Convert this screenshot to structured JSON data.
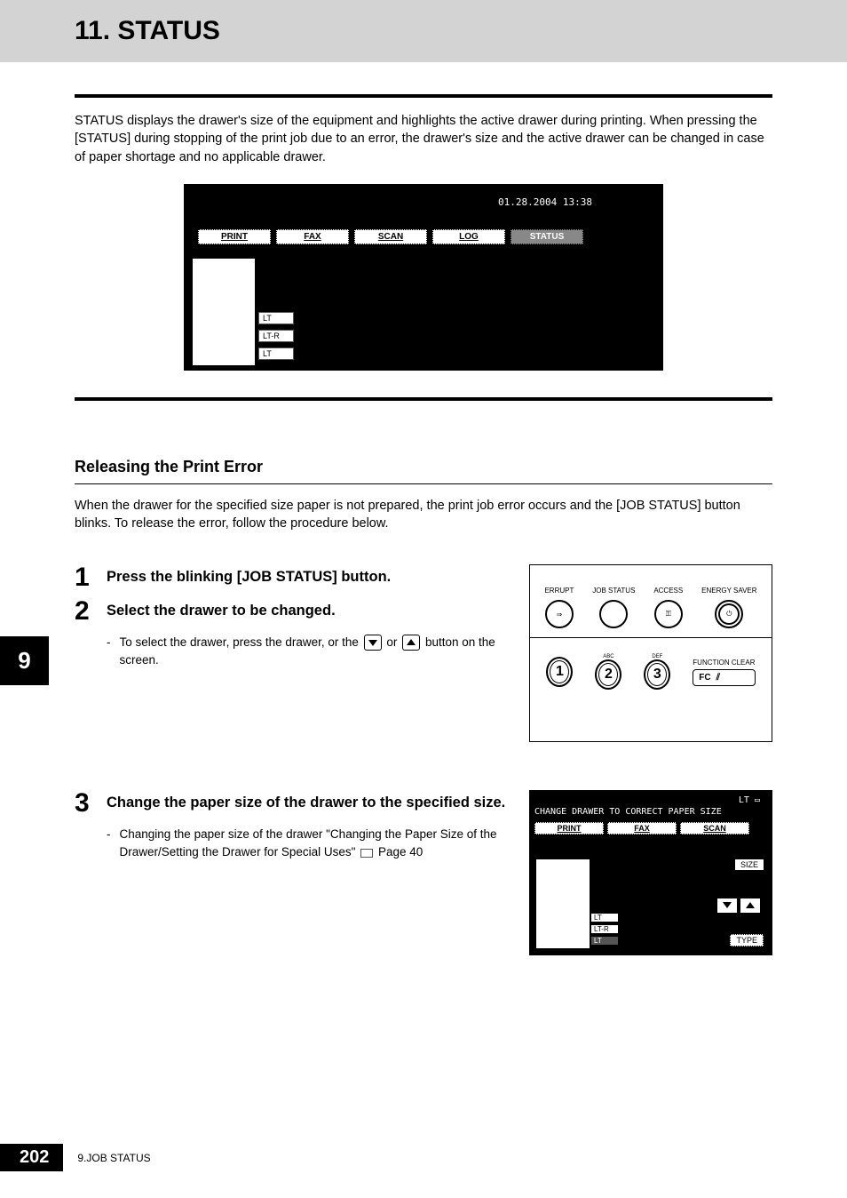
{
  "header": {
    "title": "11. STATUS"
  },
  "intro": "STATUS displays the drawer's size of the equipment and highlights the active drawer during printing. When pressing the [STATUS] during stopping of the print job due to an error, the drawer's size and the active drawer can be changed in case of paper shortage and no applicable drawer.",
  "screen1": {
    "datetime": "01.28.2004 13:38",
    "tabs": {
      "print": "PRINT",
      "fax": "FAX",
      "scan": "SCAN",
      "log": "LOG",
      "status": "STATUS"
    },
    "drawers": {
      "d1": "LT",
      "d2": "LT-R",
      "d3": "LT"
    }
  },
  "subsection": {
    "title": "Releasing the Print Error",
    "text": "When the drawer for the specified size paper is not prepared, the print job error occurs and the [JOB STATUS] button blinks. To release the error, follow the procedure below."
  },
  "steps": {
    "s1": {
      "num": "1",
      "title": "Press the blinking [JOB STATUS] button."
    },
    "s2": {
      "num": "2",
      "title": "Select the drawer to be changed.",
      "sub_pre": "To select the drawer, press the drawer, or the",
      "sub_mid": "or",
      "sub_post": "button on the screen."
    },
    "s3": {
      "num": "3",
      "title": "Change the paper size of the drawer to the specified size.",
      "sub": "Changing the paper size of the drawer \"Changing the Paper Size of the Drawer/Setting the Drawer for Special Uses\"",
      "ref": "Page 40"
    }
  },
  "panel": {
    "errupt": "ERRUPT",
    "jobstatus": "JOB STATUS",
    "access": "ACCESS",
    "energy": "ENERGY SAVER",
    "funcclear": "FUNCTION CLEAR",
    "fc": "FC",
    "k1": "1",
    "k2": "2",
    "k3": "3",
    "abc": "ABC",
    "def": "DEF"
  },
  "screen2": {
    "top": "LT",
    "msg": "CHANGE DRAWER TO CORRECT PAPER SIZE",
    "tabs": {
      "print": "PRINT",
      "fax": "FAX",
      "scan": "SCAN"
    },
    "size": "SIZE",
    "type": "TYPE",
    "drawers": {
      "d1": "LT",
      "d2": "LT-R",
      "d3": "LT"
    }
  },
  "side": {
    "chapter": "9"
  },
  "footer": {
    "page": "202",
    "label": "9.JOB STATUS"
  }
}
